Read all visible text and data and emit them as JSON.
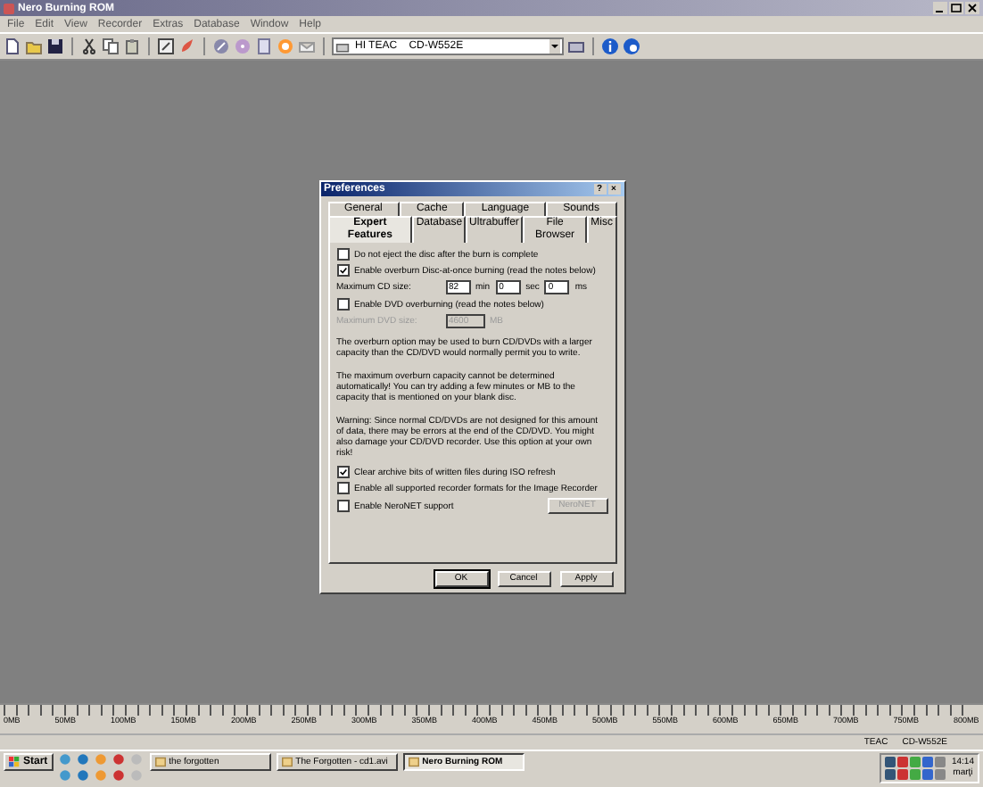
{
  "window": {
    "title": "Nero Burning ROM"
  },
  "menu": [
    "File",
    "Edit",
    "View",
    "Recorder",
    "Extras",
    "Database",
    "Window",
    "Help"
  ],
  "toolbar": {
    "drive": "HI TEAC    CD-W552E"
  },
  "dialog": {
    "title": "Preferences",
    "help": "?",
    "close": "×",
    "tab_rows": [
      [
        {
          "label": "General",
          "selected": false
        },
        {
          "label": "Cache",
          "selected": false
        },
        {
          "label": "Language",
          "selected": false
        },
        {
          "label": "Sounds",
          "selected": false
        }
      ],
      [
        {
          "label": "Expert Features",
          "selected": true
        },
        {
          "label": "Database",
          "selected": false
        },
        {
          "label": "Ultrabuffer",
          "selected": false
        },
        {
          "label": "File Browser",
          "selected": false
        },
        {
          "label": "Misc",
          "selected": false
        }
      ]
    ],
    "items": [
      {
        "kind": "checkbox",
        "label": "Do not eject the disc after the burn is complete",
        "checked": false,
        "disabled": false
      },
      {
        "kind": "checkbox",
        "label": "Enable overburn Disc-at-once burning (read the notes below)",
        "checked": true,
        "disabled": false
      },
      {
        "kind": "size",
        "label": "Maximum CD size:",
        "fields": [
          {
            "value": "82",
            "unit": "min"
          },
          {
            "value": "0",
            "unit": "sec"
          },
          {
            "value": "0",
            "unit": "ms"
          }
        ],
        "disabled": false
      },
      {
        "kind": "checkbox",
        "label": "Enable DVD overburning (read the notes below)",
        "checked": false,
        "disabled": false
      },
      {
        "kind": "size",
        "label": "Maximum DVD size:",
        "fields": [
          {
            "value": "4600",
            "unit": "MB"
          }
        ],
        "disabled": true
      },
      {
        "kind": "text",
        "label": "The overburn option may be used to burn CD/DVDs with a larger capacity than the CD/DVD would normally permit you to write."
      },
      {
        "kind": "text",
        "label": "The maximum overburn capacity cannot be determined automatically! You can try adding a few minutes or MB to the capacity that is mentioned on your blank disc."
      },
      {
        "kind": "text",
        "label": "Warning: Since normal CD/DVDs are not designed for this amount of data, there may be errors at the end of the CD/DVD. You might also damage your CD/DVD recorder. Use this option at your own risk!"
      },
      {
        "kind": "checkbox",
        "label": "Clear archive bits of written files during ISO refresh",
        "checked": true,
        "disabled": false
      },
      {
        "kind": "checkbox",
        "label": "Enable all supported recorder formats for the Image Recorder",
        "checked": false,
        "disabled": false
      },
      {
        "kind": "checkbox",
        "label": "Enable NeroNET support",
        "checked": false,
        "disabled": false,
        "button": {
          "label": "NeroNET",
          "disabled": true
        }
      }
    ],
    "buttons": [
      "OK",
      "Cancel",
      "Apply"
    ]
  },
  "ruler": [
    "0MB",
    "50MB",
    "100MB",
    "150MB",
    "200MB",
    "250MB",
    "300MB",
    "350MB",
    "400MB",
    "450MB",
    "500MB",
    "550MB",
    "600MB",
    "650MB",
    "700MB",
    "750MB",
    "800MB"
  ],
  "status_bar": {
    "recorder": "TEAC",
    "model": "CD-W552E"
  },
  "taskbar": {
    "start": "Start",
    "tasks": [
      {
        "label": "the forgotten",
        "selected": false
      },
      {
        "label": "The Forgotten - cd1.avi",
        "selected": false
      },
      {
        "label": "Nero Burning ROM",
        "selected": true
      }
    ],
    "clock": "14:14",
    "day": "marţi"
  }
}
